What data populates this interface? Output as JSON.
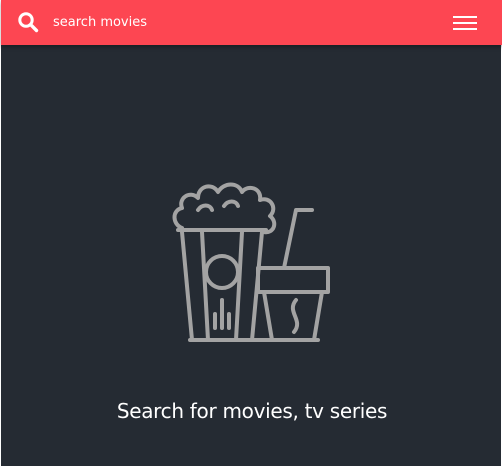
{
  "header": {
    "search_placeholder": "search movies",
    "search_icon": "search-icon",
    "menu_icon": "hamburger-menu-icon"
  },
  "main": {
    "illustration_icon": "popcorn-and-drink-icon",
    "empty_message": "Search for movies, tv series"
  },
  "colors": {
    "header_background": "#fd4652",
    "page_background": "#252b33",
    "illustration_stroke": "#a3a3a3",
    "text": "#ffffff"
  }
}
